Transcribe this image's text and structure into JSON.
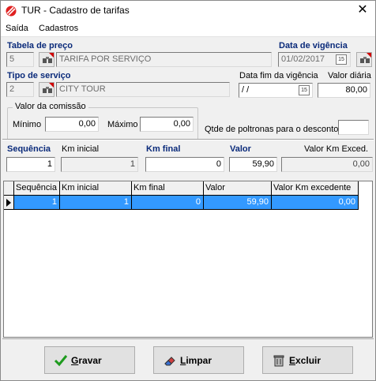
{
  "window": {
    "title": "TUR - Cadastro de tarifas",
    "icon": "app-logo-icon",
    "close_glyph": "✕"
  },
  "menu": {
    "items": [
      "Saída",
      "Cadastros"
    ]
  },
  "tabela_preco": {
    "label": "Tabela de preço",
    "code": "5",
    "name": "TARIFA POR SERVIÇO"
  },
  "data_vigencia": {
    "label": "Data de vigência",
    "value": "01/02/2017",
    "cal_icon": "15"
  },
  "tipo_servico": {
    "label": "Tipo de serviço",
    "code": "2",
    "name": "CITY TOUR"
  },
  "data_fim": {
    "label": "Data fim da vigência",
    "value": " / /",
    "cal_icon": "15"
  },
  "valor_diaria": {
    "label": "Valor diária",
    "value": "80,00"
  },
  "comissao": {
    "legend": "Valor da comissão",
    "min_label": "Mínimo",
    "min_value": "0,00",
    "max_label": "Máximo",
    "max_value": "0,00"
  },
  "poltronas": {
    "label": "Qtde de poltronas para o desconto",
    "value": ""
  },
  "entry": {
    "sequencia": {
      "label": "Sequência",
      "value": "1"
    },
    "km_inicial": {
      "label": "Km inicial",
      "value": "1"
    },
    "km_final": {
      "label": "Km final",
      "value": "0"
    },
    "valor": {
      "label": "Valor",
      "value": "59,90"
    },
    "valor_km": {
      "label": "Valor Km Exced.",
      "value": "0,00"
    }
  },
  "grid": {
    "columns": [
      "Sequência",
      "Km inicial",
      "Km final",
      "Valor",
      "Valor Km excedente"
    ],
    "rows": [
      [
        "1",
        "1",
        "0",
        "59,90",
        "0,00"
      ]
    ]
  },
  "buttons": {
    "gravar": {
      "label": "Gravar",
      "underline": "G",
      "rest": "ravar",
      "icon": "checkmark-icon",
      "color": "#1e9b1e"
    },
    "limpar": {
      "label": "Limpar",
      "underline": "L",
      "rest": "impar",
      "icon": "eraser-icon"
    },
    "excluir": {
      "label": "Excluir",
      "underline": "E",
      "rest": "xcluir",
      "icon": "trash-icon"
    }
  },
  "colors": {
    "selection": "#3399ff",
    "label_blue": "#0a2a7a",
    "marker_red": "#d00000"
  }
}
